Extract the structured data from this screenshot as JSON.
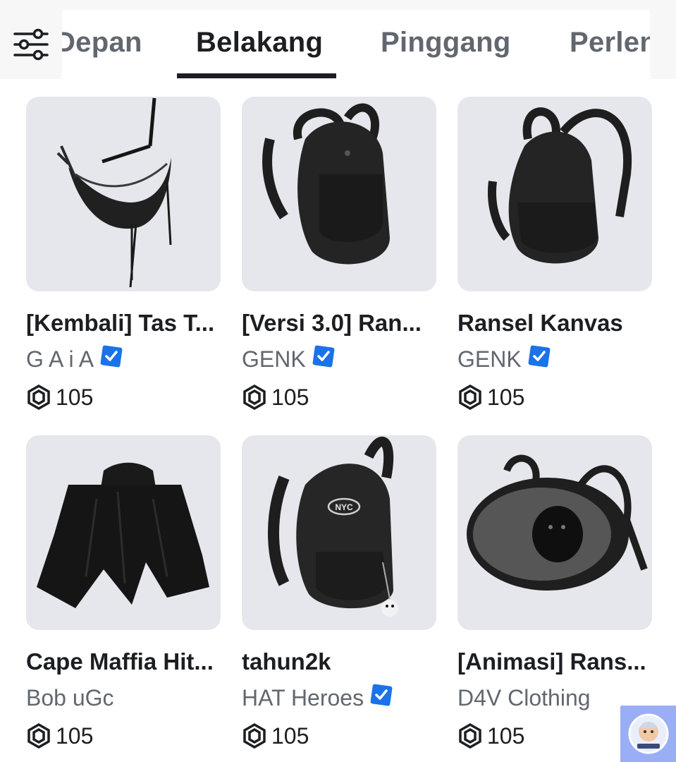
{
  "tabs": [
    {
      "label": "Depan"
    },
    {
      "label": "Belakang"
    },
    {
      "label": "Pinggang"
    },
    {
      "label": "Perlengkapan"
    }
  ],
  "active_tab": "Belakang",
  "items": [
    {
      "name": "[Kembali] Tas T...",
      "creator": "G A i A",
      "verified": true,
      "price": "105",
      "thumb_icon": "shoulder-bag-icon"
    },
    {
      "name": "[Versi 3.0] Ran...",
      "creator": "GENK",
      "verified": true,
      "price": "105",
      "thumb_icon": "backpack-icon"
    },
    {
      "name": "Ransel Kanvas",
      "creator": "GENK",
      "verified": true,
      "price": "105",
      "thumb_icon": "backpack-icon"
    },
    {
      "name": "Cape Maffia Hit...",
      "creator": "Bob uGc",
      "verified": false,
      "price": "105",
      "thumb_icon": "cape-icon"
    },
    {
      "name": "tahun2k",
      "creator": "HAT Heroes",
      "verified": true,
      "price": "105",
      "thumb_icon": "nyc-backpack-icon"
    },
    {
      "name": "[Animasi] Rans...",
      "creator": "D4V Clothing",
      "verified": false,
      "price": "105",
      "thumb_icon": "eyeball-backpack-icon"
    }
  ],
  "colors": {
    "accent_verified": "#1a73e8",
    "tab_active": "#1c1e22",
    "tab_inactive": "#62676f",
    "thumb_bg": "#e6e7ec"
  }
}
